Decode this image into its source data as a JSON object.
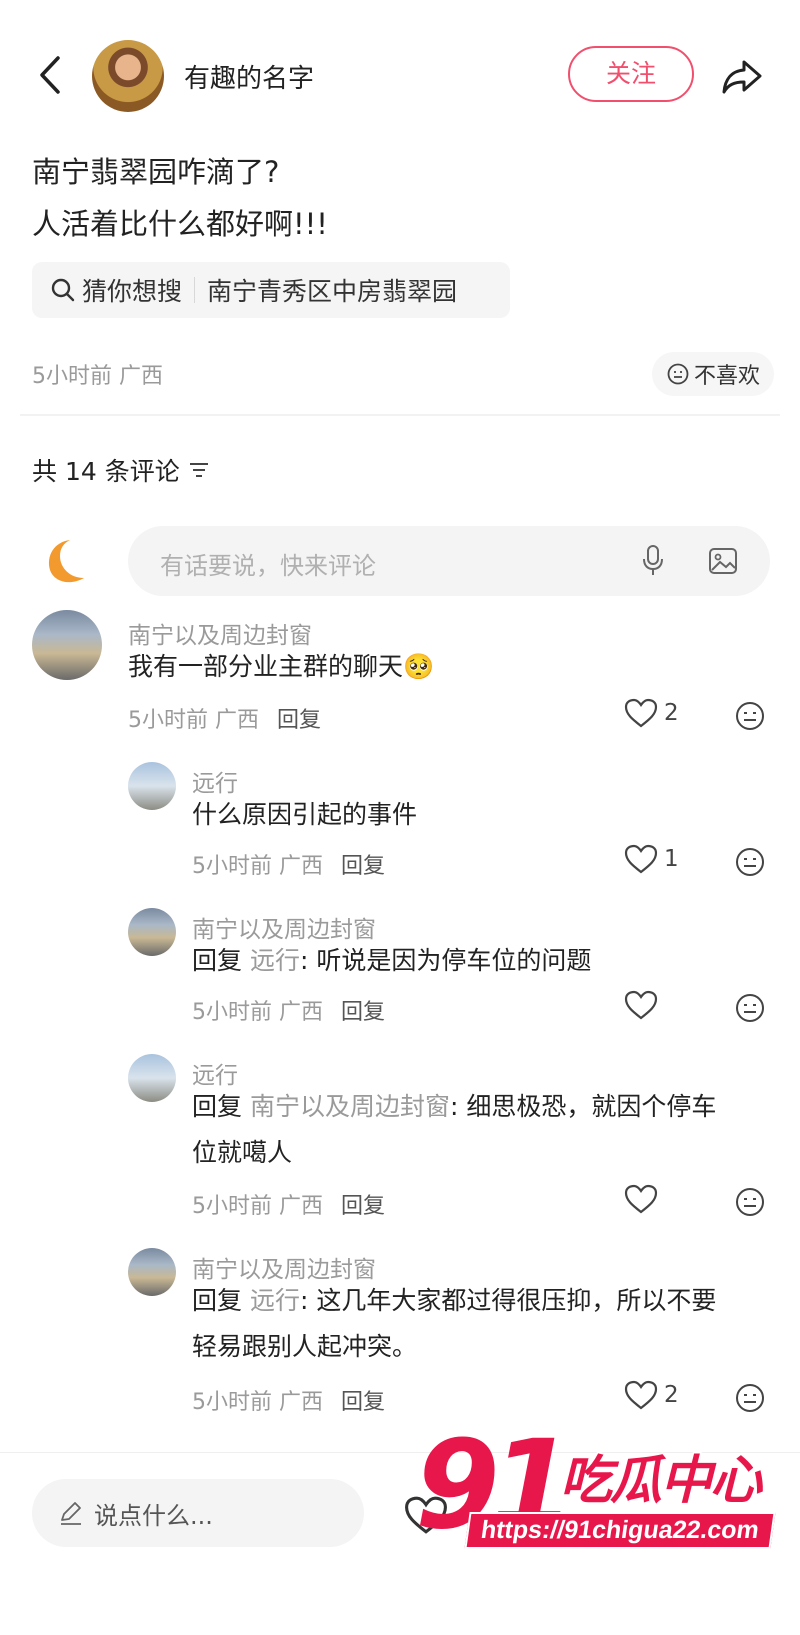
{
  "header": {
    "author_name": "有趣的名字",
    "follow_label": "关注"
  },
  "post": {
    "lines": [
      "南宁翡翠园咋滴了?",
      "人活着比什么都好啊!!!"
    ],
    "search_chip_label": "猜你想搜",
    "search_chip_query": "南宁青秀区中房翡翠园",
    "meta": "5小时前 广西",
    "dislike_label": "不喜欢"
  },
  "comments_section": {
    "count_label": "共 14 条评论",
    "input_placeholder": "有话要说，快来评论"
  },
  "comments": [
    {
      "user": "南宁以及周边封窗",
      "text": "我有一部分业主群的聊天🥺",
      "meta": "5小时前 广西",
      "reply_label": "回复",
      "likes": "2"
    },
    {
      "user": "远行",
      "text": "什么原因引起的事件",
      "meta": "5小时前 广西",
      "reply_label": "回复",
      "likes": "1"
    },
    {
      "user": "南宁以及周边封窗",
      "reply_prefix": "回复",
      "reply_to": "远行",
      "text": ": 听说是因为停车位的问题",
      "meta": "5小时前 广西",
      "reply_label": "回复",
      "likes": ""
    },
    {
      "user": "远行",
      "reply_prefix": "回复",
      "reply_to": "南宁以及周边封窗",
      "text": ": 细思极恐，就因个停车",
      "text_line2": "位就噶人",
      "meta": "5小时前 广西",
      "reply_label": "回复",
      "likes": ""
    },
    {
      "user": "南宁以及周边封窗",
      "reply_prefix": "回复",
      "reply_to": "远行",
      "text": ": 这几年大家都过得很压抑，所以不要",
      "text_line2": "轻易跟别人起冲突。",
      "meta": "5小时前 广西",
      "reply_label": "回复",
      "likes": "2"
    }
  ],
  "bottom_bar": {
    "input_placeholder": "说点什么..."
  },
  "watermark": {
    "number": "91",
    "brand": "吃瓜中心",
    "url": "https://91chigua22.com"
  },
  "colors": {
    "accent": "#f0506e",
    "watermark": "#e8174b",
    "muted_text": "#9a9a9a"
  }
}
